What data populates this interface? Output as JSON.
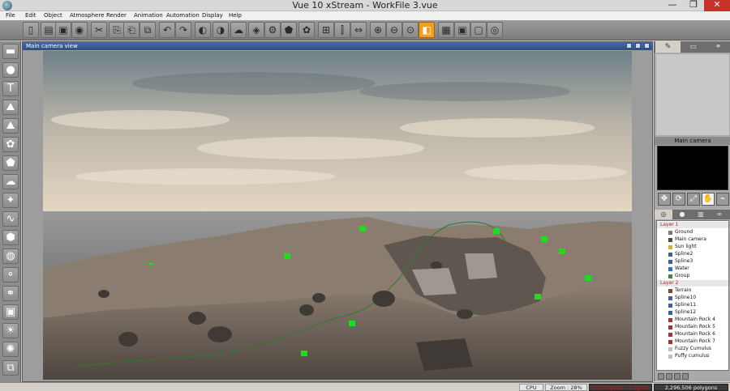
{
  "window": {
    "title": "Vue 10 xStream - WorkFile 3.vue",
    "min_glyph": "—",
    "max_glyph": "❐",
    "close_glyph": "✕"
  },
  "menubar": [
    "File",
    "Edit",
    "Object",
    "Atmosphere",
    "Render",
    "Animation",
    "Automation",
    "Display",
    "Help"
  ],
  "toolbar": {
    "icons": [
      "new-file-icon",
      "open-file-icon",
      "save-icon",
      "materials-icon",
      "cut-icon",
      "copy-icon",
      "paste-icon",
      "duplicate-icon",
      "undo-icon",
      "redo-icon",
      "render-icon",
      "render-options-icon",
      "atmosphere-icon",
      "cube-icon",
      "filter-icon",
      "rock-icon",
      "color-palette-icon",
      "pivot-icon",
      "align-icon",
      "scale-icon",
      "zoom-in-icon",
      "zoom-out-icon",
      "zoom-fit-icon",
      "single-view-icon",
      "film-icon",
      "clapper-icon",
      "frame-icon",
      "network-icon"
    ],
    "active_index": 23
  },
  "left_tools": [
    "ground-plane-icon",
    "sphere-icon",
    "text-icon",
    "terrain-icon",
    "mountains-icon",
    "plant-icon",
    "rock-icon",
    "cloud-icon",
    "light-icon",
    "spline-icon",
    "primitives-icon",
    "material-sphere-icon",
    "metaball-icon",
    "link-icon",
    "group-icon",
    "sun-icon",
    "atmosphere-editor-icon",
    "layers-icon"
  ],
  "viewport": {
    "title": "Main camera view",
    "sky_top": "#72848c",
    "sky_horizon": "#e4d6c2",
    "ground_color": "#6d6258",
    "water_color": "#8a8a8a",
    "marker_color": "#19e01b"
  },
  "right_panel": {
    "tabs": [
      "pencil-icon",
      "ruler-icon",
      "nodes-icon"
    ],
    "camera_title": "Main camera",
    "camera_controls": [
      "pan-icon",
      "orbit-icon",
      "fit-icon",
      "hand-icon",
      "wand-icon"
    ],
    "library_tabs": [
      "objects-tab-icon",
      "materials-tab-icon",
      "library-tab-icon",
      "links-tab-icon"
    ],
    "tree": [
      {
        "label": "Layer 1",
        "kind": "layer"
      },
      {
        "label": "Ground",
        "kind": "item",
        "color": "#7a7a7a"
      },
      {
        "label": "Main camera",
        "kind": "item",
        "color": "#4a4a4a"
      },
      {
        "label": "Sun light",
        "kind": "item",
        "color": "#e0b020"
      },
      {
        "label": "Spline2",
        "kind": "item",
        "color": "#406090"
      },
      {
        "label": "Spline3",
        "kind": "item",
        "color": "#406090"
      },
      {
        "label": "Water",
        "kind": "item",
        "color": "#3070c0"
      },
      {
        "label": "Group",
        "kind": "item",
        "color": "#3a8a3a"
      },
      {
        "label": "Layer 2",
        "kind": "layer"
      },
      {
        "label": "Terrain",
        "kind": "item",
        "color": "#7a4a2a"
      },
      {
        "label": "Spline10",
        "kind": "item",
        "color": "#406090"
      },
      {
        "label": "Spline11",
        "kind": "item",
        "color": "#406090"
      },
      {
        "label": "Spline12",
        "kind": "item",
        "color": "#406090"
      },
      {
        "label": "Mountain Rock 4",
        "kind": "item",
        "color": "#a83030"
      },
      {
        "label": "Mountain Rock 5",
        "kind": "item",
        "color": "#a83030"
      },
      {
        "label": "Mountain Rock 6",
        "kind": "item",
        "color": "#a83030"
      },
      {
        "label": "Mountain Rock 7",
        "kind": "item",
        "color": "#a83030"
      },
      {
        "label": "Fuzzy Cumulus",
        "kind": "item",
        "color": "#c0c0c0"
      },
      {
        "label": "Puffy cumulus",
        "kind": "item",
        "color": "#c0c0c0"
      }
    ]
  },
  "statusbar": {
    "cpu": "CPU",
    "zoom": "Zoom : 28%",
    "objects": "207 objects - 1 lights",
    "polygons": "2,296,506 polygons"
  }
}
